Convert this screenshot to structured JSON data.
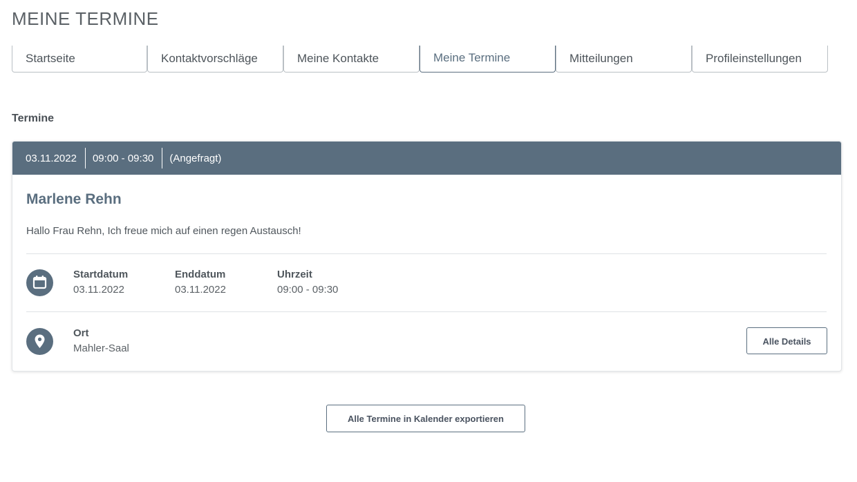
{
  "page": {
    "title": "MEINE TERMINE"
  },
  "tabs": [
    {
      "label": "Startseite"
    },
    {
      "label": "Kontaktvorschläge"
    },
    {
      "label": "Meine Kontakte"
    },
    {
      "label": "Meine Termine",
      "active": true
    },
    {
      "label": "Mitteilungen"
    },
    {
      "label": "Profileinstellungen"
    }
  ],
  "section": {
    "label": "Termine"
  },
  "appointment": {
    "header": {
      "date": "03.11.2022",
      "time": "09:00 - 09:30",
      "status": "(Angefragt)"
    },
    "name": "Marlene Rehn",
    "message": "Hallo Frau Rehn, Ich freue mich auf einen regen Austausch!",
    "schedule": {
      "icon": "calendar-icon",
      "start_label": "Startdatum",
      "start_value": "03.11.2022",
      "end_label": "Enddatum",
      "end_value": "03.11.2022",
      "time_label": "Uhrzeit",
      "time_value": "09:00 - 09:30"
    },
    "location": {
      "icon": "location-pin-icon",
      "label": "Ort",
      "value": "Mahler-Saal"
    },
    "details_button": "Alle Details"
  },
  "export_button": "Alle Termine in Kalender exportieren",
  "colors": {
    "accent": "#5a6e7f",
    "border": "#b9bfc4",
    "text": "#4f565c"
  }
}
